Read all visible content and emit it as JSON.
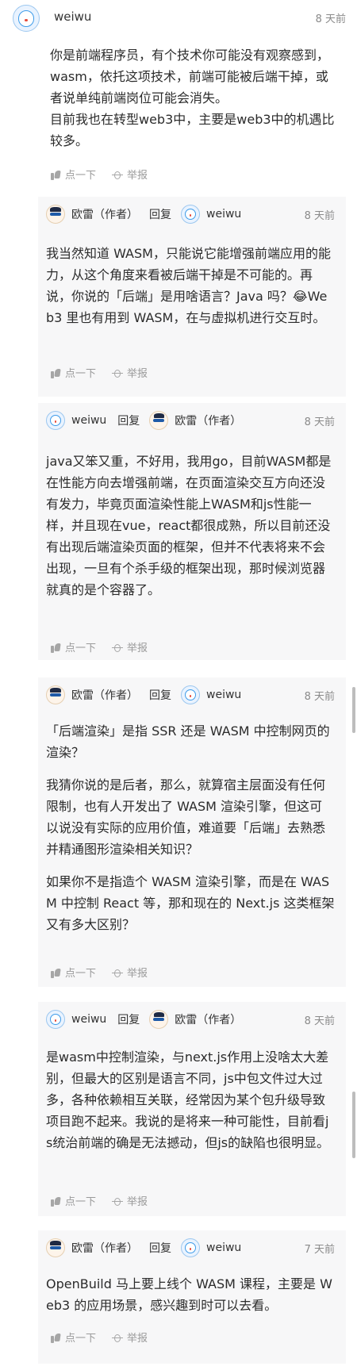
{
  "top_comment": {
    "author": "weiwu",
    "time": "8 天前",
    "paragraphs": [
      "你是前端程序员，有个技术你可能没有观察感到，wasm，依托这项技术，前端可能被后端干掉，或者说单纯前端岗位可能会消失。",
      "目前我也在转型web3中，主要是web3中的机遇比较多。"
    ],
    "like_label": "点一下",
    "report_label": "举报"
  },
  "reply_word": "回复",
  "replies": [
    {
      "from": "欧雷（作者）",
      "from_avatar": "nerd",
      "to": "weiwu",
      "to_avatar": "dora",
      "time": "8 天前",
      "paragraphs": [
        "我当然知道 WASM，只能说它能增强前端应用的能力，从这个角度来看被后端干掉是不可能的。再说，你说的「后端」是用啥语言？Java 吗？😂Web3 里也有用到 WASM，在与虚拟机进行交互时。"
      ],
      "like_label": "点一下",
      "report_label": "举报"
    },
    {
      "from": "weiwu",
      "from_avatar": "dora",
      "to": "欧雷（作者）",
      "to_avatar": "nerd",
      "time": "8 天前",
      "paragraphs": [
        "java又笨又重，不好用，我用go，目前WASM都是在性能方向去增强前端，在页面渲染交互方向还没有发力，毕竟页面渲染性能上WASM和js性能一样，并且现在vue，react都很成熟，所以目前还没有出现后端渲染页面的框架，但并不代表将来不会出现，一旦有个杀手级的框架出现，那时候浏览器就真的是个容器了。"
      ],
      "like_label": "点一下",
      "report_label": "举报"
    },
    {
      "from": "欧雷（作者）",
      "from_avatar": "nerd",
      "to": "weiwu",
      "to_avatar": "dora",
      "time": "8 天前",
      "paragraphs": [
        "「后端渲染」是指 SSR 还是 WASM 中控制网页的渲染？",
        "我猜你说的是后者，那么，就算宿主层面没有任何限制，也有人开发出了 WASM 渲染引擎，但这可以说没有实际的应用价值，难道要「后端」去熟悉并精通图形渲染相关知识？",
        "如果你不是指造个 WASM 渲染引擎，而是在 WASM 中控制 React 等，那和现在的 Next.js 这类框架又有多大区别？"
      ],
      "like_label": "点一下",
      "report_label": "举报"
    },
    {
      "from": "weiwu",
      "from_avatar": "dora",
      "to": "欧雷（作者）",
      "to_avatar": "nerd",
      "time": "8 天前",
      "paragraphs": [
        "是wasm中控制渲染，与next.js作用上没啥太大差别，但最大的区别是语言不同，js中包文件过大过多，各种依赖相互关联，经常因为某个包升级导致项目跑不起来。我说的是将来一种可能性，目前看js统治前端的确是无法撼动，但js的缺陷也很明显。"
      ],
      "like_label": "点一下",
      "report_label": "举报"
    },
    {
      "from": "欧雷（作者）",
      "from_avatar": "nerd",
      "to": "weiwu",
      "to_avatar": "dora",
      "time": "7 天前",
      "paragraphs": [
        "OpenBuild 马上要上线个 WASM 课程，主要是 Web3 的应用场景，感兴趣到时可以去看。"
      ],
      "like_label": "点一下",
      "report_label": "举报"
    }
  ]
}
